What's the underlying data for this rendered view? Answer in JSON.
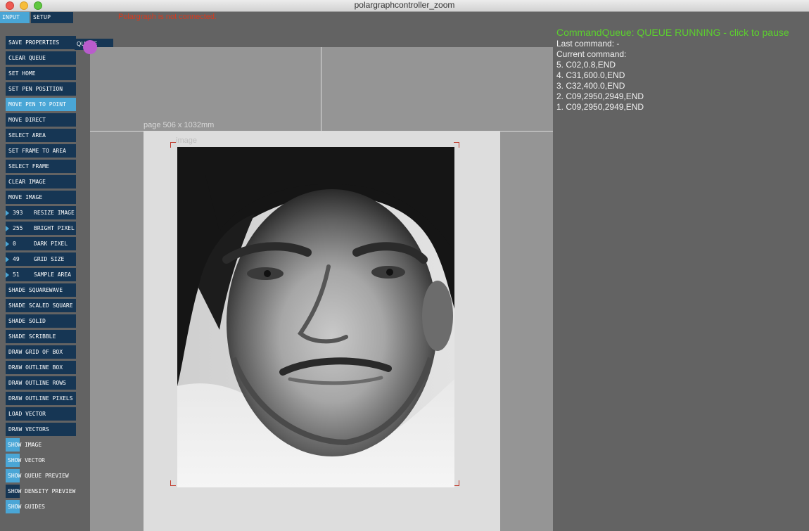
{
  "window": {
    "title": "polargraphcontroller_zoom"
  },
  "tabs": [
    {
      "label": "INPUT",
      "active": true
    },
    {
      "label": "SETUP",
      "active": false
    },
    {
      "label": "QUEUE",
      "active": false
    }
  ],
  "status": {
    "connection": "Polargraph is not connected."
  },
  "buttons": {
    "save_properties": "SAVE PROPERTIES",
    "clear_queue": "CLEAR QUEUE",
    "set_home": "SET HOME",
    "set_pen_position": "SET PEN POSITION",
    "move_pen_to_point": "MOVE PEN TO POINT",
    "move_direct": "MOVE DIRECT",
    "select_area": "SELECT AREA",
    "set_frame_to_area": "SET FRAME TO AREA",
    "select_frame": "SELECT FRAME",
    "clear_image": "CLEAR IMAGE",
    "move_image": "MOVE IMAGE",
    "shade_squarewave": "SHADE SQUAREWAVE",
    "shade_scaled_square": "SHADE SCALED SQUARE",
    "shade_solid": "SHADE SOLID",
    "shade_scribble": "SHADE SCRIBBLE",
    "draw_grid_of_box": "DRAW GRID OF BOX",
    "draw_outline_box": "DRAW OUTLINE BOX",
    "draw_outline_rows": "DRAW OUTLINE ROWS",
    "draw_outline_pixels": "DRAW OUTLINE PIXELS",
    "load_vector": "LOAD VECTOR",
    "draw_vectors": "DRAW VECTORS"
  },
  "numeric": {
    "resize_image": {
      "value": "393",
      "label": "RESIZE IMAGE"
    },
    "bright_pixel": {
      "value": "255",
      "label": "BRIGHT PIXEL"
    },
    "dark_pixel": {
      "value": "0",
      "label": "DARK PIXEL"
    },
    "grid_size": {
      "value": "49",
      "label": "GRID SIZE"
    },
    "sample_area": {
      "value": "51",
      "label": "SAMPLE AREA"
    }
  },
  "toggles": {
    "show_image": {
      "label": "SHOW IMAGE",
      "on": true
    },
    "show_vector": {
      "label": "SHOW VECTOR",
      "on": true
    },
    "show_queue_preview": {
      "label": "SHOW QUEUE PREVIEW",
      "on": true
    },
    "show_density_preview": {
      "label": "SHOW DENSITY PREVIEW",
      "on": false
    },
    "show_guides": {
      "label": "SHOW GUIDES",
      "on": true
    }
  },
  "canvas": {
    "page_label": "page 506 x 1032mm",
    "image_label": "image"
  },
  "queue": {
    "header": "CommandQueue: QUEUE RUNNING - click to pause",
    "last_command": "Last command: -",
    "current_command": "Current command:",
    "items": [
      "5. C02,0.8,END",
      "4. C31,600.0,END",
      "3. C32,400.0,END",
      "2. C09,2950,2949,END",
      "1. C09,2950,2949,END"
    ]
  },
  "colors": {
    "button": "#163654",
    "button_active": "#4aa6d6",
    "queue_header": "#5cd02e",
    "error": "#d83a1e"
  }
}
